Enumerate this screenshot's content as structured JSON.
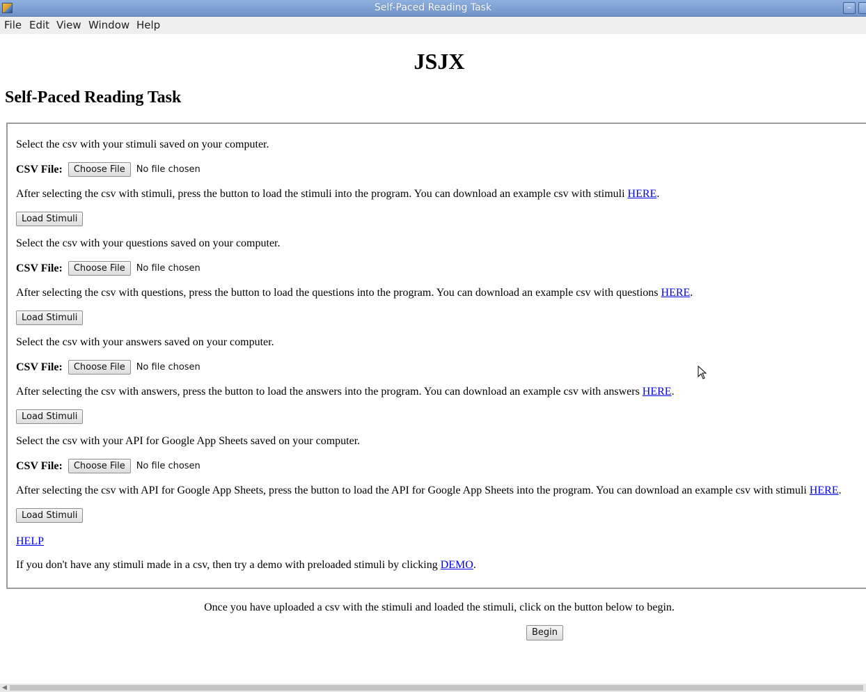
{
  "window": {
    "title": "Self-Paced Reading Task"
  },
  "menu": [
    "File",
    "Edit",
    "View",
    "Window",
    "Help"
  ],
  "header": {
    "h1": "JSJX",
    "h2": "Self-Paced Reading Task"
  },
  "sections": [
    {
      "select_text": "Select the csv with your stimuli saved on your computer.",
      "file_label": "CSV File:",
      "choose_label": "Choose File",
      "file_status": "No file chosen",
      "after_text": "After selecting the csv with stimuli, press the button to load the stimuli into the program. You can download an example csv with stimuli ",
      "link": "HERE",
      "button": "Load Stimuli"
    },
    {
      "select_text": "Select the csv with your questions saved on your computer.",
      "file_label": "CSV File:",
      "choose_label": "Choose File",
      "file_status": "No file chosen",
      "after_text": "After selecting the csv with questions, press the button to load the questions into the program. You can download an example csv with questions ",
      "link": "HERE",
      "button": "Load Stimuli"
    },
    {
      "select_text": "Select the csv with your answers saved on your computer.",
      "file_label": "CSV File:",
      "choose_label": "Choose File",
      "file_status": "No file chosen",
      "after_text": "After selecting the csv with answers, press the button to load the answers into the program. You can download an example csv with answers ",
      "link": "HERE",
      "button": "Load Stimuli"
    },
    {
      "select_text": "Select the csv with your API for Google App Sheets saved on your computer.",
      "file_label": "CSV File:",
      "choose_label": "Choose File",
      "file_status": "No file chosen",
      "after_text": "After selecting the csv with API for Google App Sheets, press the button to load the API for Google App Sheets into the program. You can download an example csv with stimuli ",
      "link": "HERE",
      "button": "Load Stimuli"
    }
  ],
  "help_link": "HELP",
  "demo": {
    "text": "If you don't have any stimuli made in a csv, then try a demo with preloaded stimuli by clicking ",
    "link": "DEMO"
  },
  "instruction": "Once you have uploaded a csv with the stimuli and loaded the stimuli, click on the button below to begin.",
  "begin_button": "Begin",
  "period": "."
}
